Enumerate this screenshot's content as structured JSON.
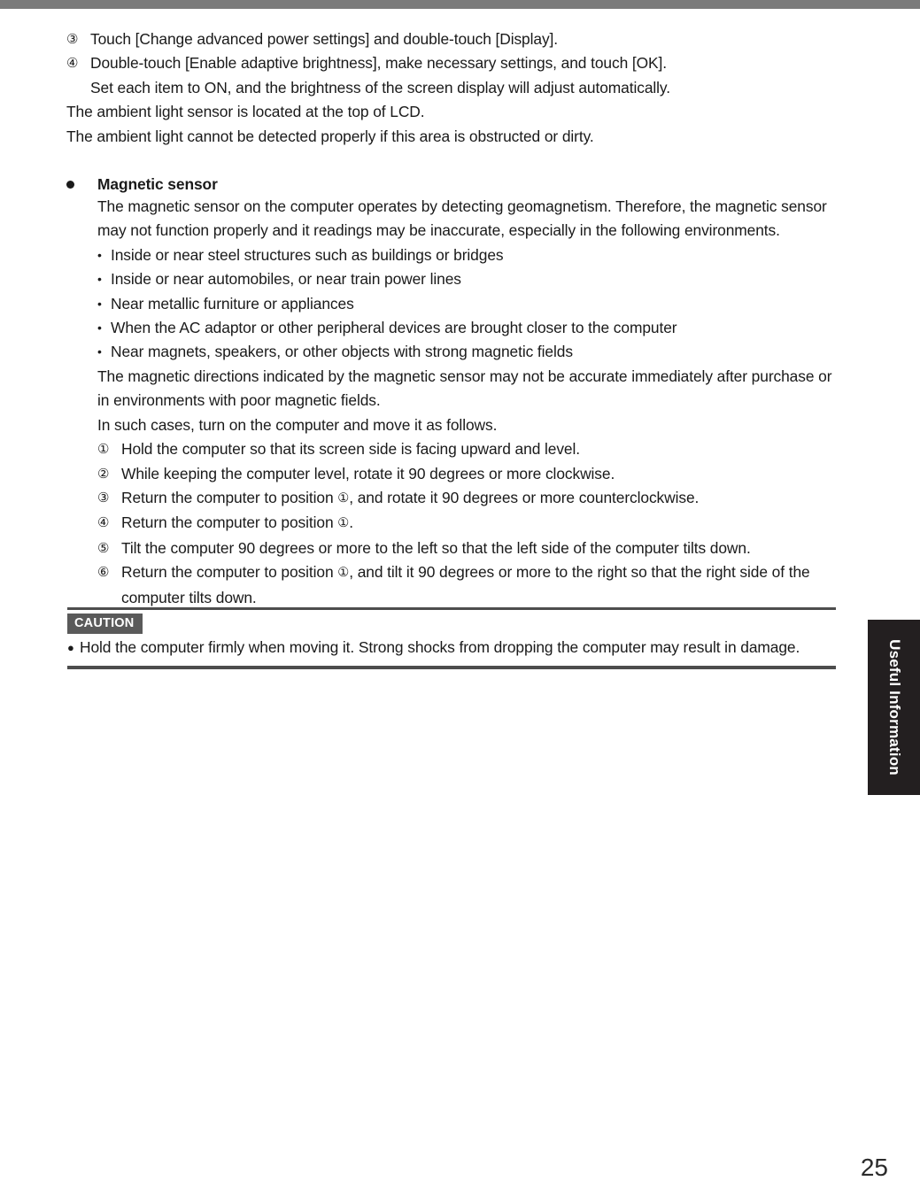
{
  "page": {
    "folio": "25",
    "side_tab_label": "Useful Information",
    "top_band_color": "#7b7b7b",
    "tab_color": "#231f20",
    "caution_tag_color": "#5a5a5a",
    "rule_color": "#4d4d4d"
  },
  "intro": {
    "steps": [
      {
        "marker": "③",
        "text": "Touch [Change advanced power settings] and double-touch [Display]."
      },
      {
        "marker": "④",
        "text": "Double-touch [Enable adaptive brightness], make necessary settings, and touch [OK]."
      }
    ],
    "step4_continuation": "Set each item to ON, and the brightness of the screen display will adjust automatically.",
    "lines": [
      "The ambient light sensor is located at the top of LCD.",
      "The ambient light cannot be detected properly if this area is obstructed or dirty."
    ]
  },
  "magnetic_sensor": {
    "bullet_glyph": "●",
    "title": "Magnetic sensor",
    "paragraph1": "The magnetic sensor on the computer operates by detecting geomagnetism. Therefore, the magnetic sensor may not function properly and it readings may be inaccurate, especially in the following environments.",
    "environment_bullet": "•",
    "environments": [
      "Inside or near steel structures such as buildings or bridges",
      "Inside or near automobiles, or near train power lines",
      "Near metallic furniture or appliances",
      "When the AC adaptor or other peripheral devices are brought closer to the computer",
      "Near magnets, speakers, or other objects with strong magnetic fields"
    ],
    "paragraph2": "The magnetic directions indicated by the magnetic sensor may not be accurate immediately after purchase or in environments with poor magnetic fields.",
    "paragraph3": "In such cases, turn on the computer and move it as follows.",
    "steps": [
      {
        "marker": "①",
        "text_before": "Hold the computer so that its screen side is facing upward and level.",
        "inline_marker": "",
        "text_after": ""
      },
      {
        "marker": "②",
        "text_before": "While keeping the computer level, rotate it 90 degrees or more clockwise.",
        "inline_marker": "",
        "text_after": ""
      },
      {
        "marker": "③",
        "text_before": "Return the computer to position ",
        "inline_marker": "①",
        "text_after": ", and rotate it 90 degrees or more counterclockwise."
      },
      {
        "marker": "④",
        "text_before": "Return the computer to position ",
        "inline_marker": "①",
        "text_after": "."
      },
      {
        "marker": "⑤",
        "text_before": "Tilt the computer 90 degrees or more to the left so that the left side of the computer tilts down.",
        "inline_marker": "",
        "text_after": ""
      },
      {
        "marker": "⑥",
        "text_before": "Return the computer to position ",
        "inline_marker": "①",
        "text_after": ", and tilt it 90 degrees or more to the right so that the right side of the computer tilts down."
      }
    ]
  },
  "caution": {
    "tag": "CAUTION",
    "bullet_glyph": "●",
    "items": [
      "Hold the computer firmly when moving it. Strong shocks from dropping the computer may result in damage."
    ]
  }
}
